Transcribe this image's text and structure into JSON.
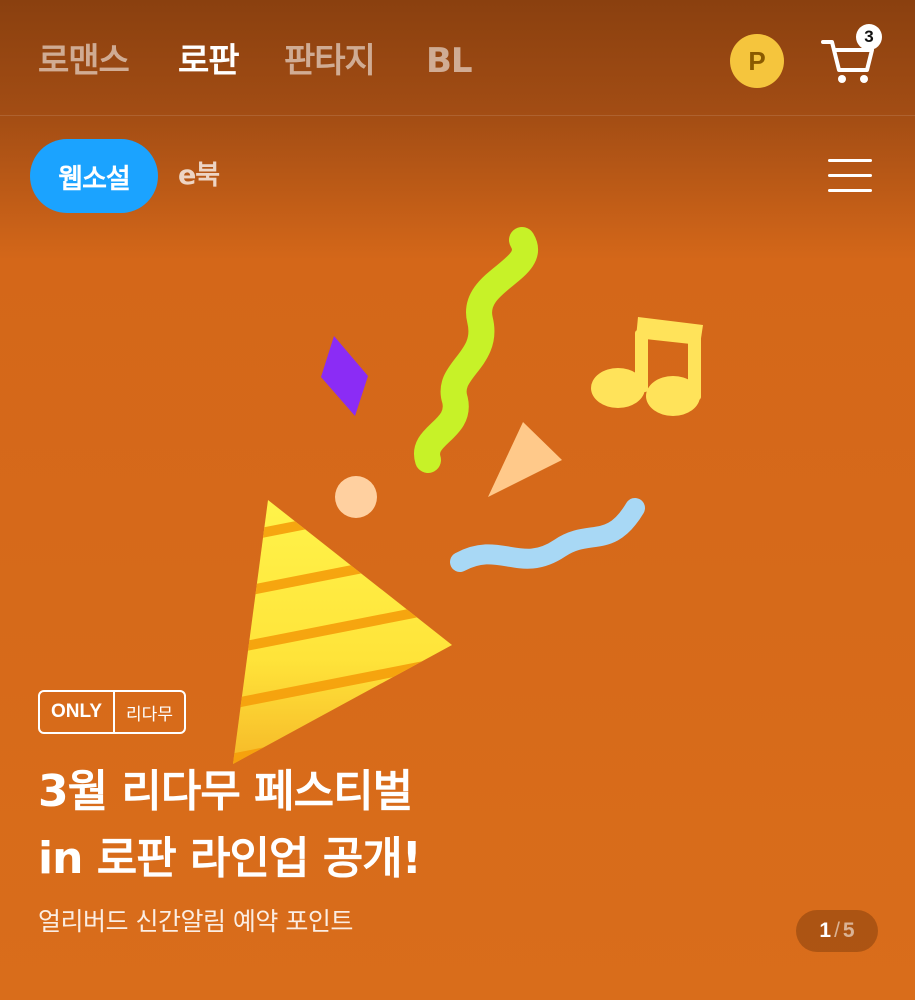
{
  "genres": [
    {
      "label": "로맨스",
      "active": false
    },
    {
      "label": "로판",
      "active": true
    },
    {
      "label": "판타지",
      "active": false
    },
    {
      "label": "BL",
      "active": false
    }
  ],
  "header": {
    "point_label": "P",
    "cart_count": "3"
  },
  "subtabs": [
    {
      "label": "웹소설",
      "active": true
    },
    {
      "label": "e북",
      "active": false
    }
  ],
  "banner": {
    "badge_only": "ONLY",
    "badge_brand": "리다무",
    "headline_line1": "3월 리다무 페스티벌",
    "headline_line2": "in 로판 라인업 공개!",
    "subtitle": "얼리버드 신간알림 예약 포인트",
    "pager_current": "1",
    "pager_separator": "/",
    "pager_total": "5"
  },
  "icons": {
    "point": "point-coin-icon",
    "cart": "cart-icon",
    "menu": "hamburger-menu-icon",
    "illustration": "party-popper-icon"
  },
  "colors": {
    "banner_bg": "#d96d1b",
    "header_bg": "#8a400f",
    "active_pill": "#1ba3ff",
    "point_coin": "#f5c53d"
  }
}
